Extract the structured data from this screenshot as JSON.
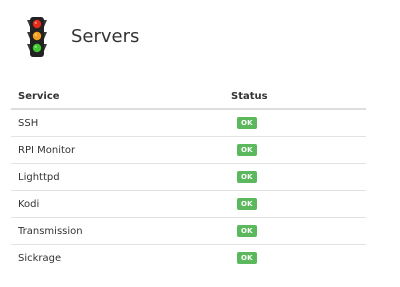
{
  "header": {
    "title": "Servers",
    "icon": "traffic-light-icon"
  },
  "table": {
    "columns": [
      "Service",
      "Status"
    ],
    "rows": [
      {
        "service": "SSH",
        "status": "OK"
      },
      {
        "service": "RPI Monitor",
        "status": "OK"
      },
      {
        "service": "Lighttpd",
        "status": "OK"
      },
      {
        "service": "Kodi",
        "status": "OK"
      },
      {
        "service": "Transmission",
        "status": "OK"
      },
      {
        "service": "Sickrage",
        "status": "OK"
      }
    ]
  },
  "colors": {
    "ok_badge": "#5cb85c",
    "light_red": "#e62a1b",
    "light_yellow": "#f2a21c",
    "light_green": "#3fca2d"
  }
}
